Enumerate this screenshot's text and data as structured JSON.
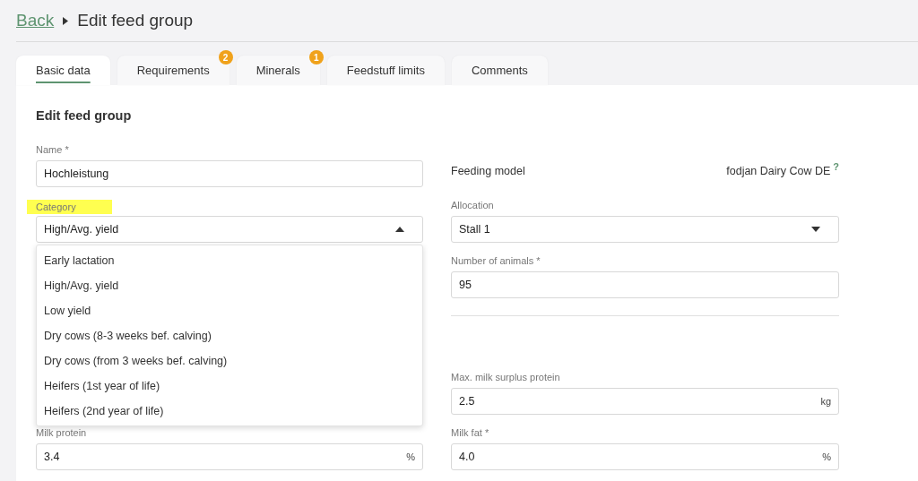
{
  "header": {
    "back_link": "Back",
    "title": "Edit feed group"
  },
  "tabs": [
    {
      "label": "Basic data",
      "selected": true
    },
    {
      "label": "Requirements",
      "selected": false,
      "badge": "2"
    },
    {
      "label": "Minerals",
      "selected": false,
      "badge": "1"
    },
    {
      "label": "Feedstuff limits",
      "selected": false
    },
    {
      "label": "Comments",
      "selected": false
    }
  ],
  "form": {
    "title": "Edit feed group",
    "sections": [
      {
        "rows": [
          {
            "left": {
              "kind": "text",
              "label": "Name *",
              "value": "Hochleistung"
            },
            "right": {
              "kind": "info",
              "label": "Feeding model",
              "value": "fodjan Dairy Cow DE",
              "help": "?"
            }
          },
          {
            "left": {
              "kind": "select",
              "label": "Category",
              "highlighted": true,
              "value": "High/Avg. yield",
              "expanded": true,
              "options": [
                {
                  "label": "Early lactation"
                },
                {
                  "label": "High/Avg. yield"
                },
                {
                  "label": "Low yield"
                },
                {
                  "label": "Dry cows (8-3 weeks bef. calving)"
                },
                {
                  "label": "Dry cows (from 3 weeks bef. calving)"
                },
                {
                  "label": "Heifers (1st year of life)"
                },
                {
                  "label": "Heifers (2nd year of life)"
                }
              ]
            },
            "right": {
              "kind": "select",
              "label": "Allocation",
              "value": "Stall 1",
              "expanded": false
            }
          },
          {
            "right": {
              "kind": "text",
              "label": "Number of animals *",
              "value": "95"
            }
          }
        ]
      },
      {
        "rows": [
          {
            "right": {
              "kind": "text",
              "label": "Max. milk surplus protein",
              "value": "2.5",
              "unit": "kg"
            }
          },
          {
            "left": {
              "kind": "text",
              "label": "Milk protein",
              "value": "3.4",
              "unit": "%"
            },
            "right": {
              "kind": "text",
              "label": "Milk fat *",
              "value": "4.0",
              "unit": "%"
            }
          }
        ]
      }
    ]
  }
}
